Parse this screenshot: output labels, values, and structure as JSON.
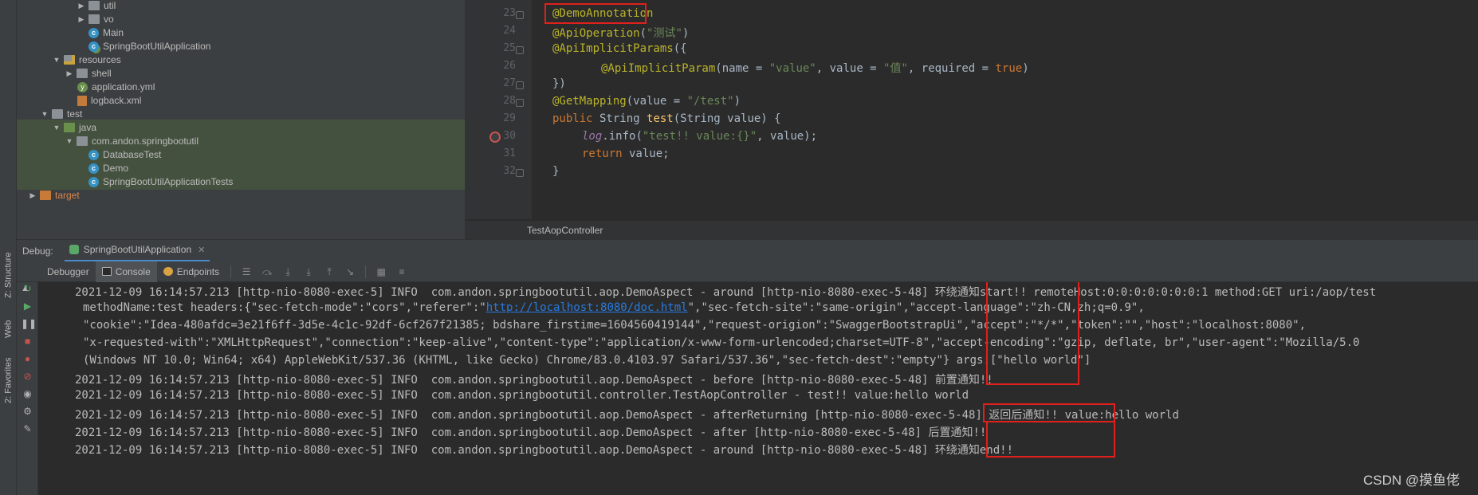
{
  "tree": {
    "items": [
      {
        "label": "util",
        "icon": "folder-icon",
        "indent": 0
      },
      {
        "label": "vo",
        "icon": "folder-icon"
      },
      {
        "label": "Main",
        "icon": "class-icon"
      },
      {
        "label": "SpringBootUtilApplication",
        "icon": "spring-class-icon"
      },
      {
        "label": "resources",
        "icon": "resources-folder-icon"
      },
      {
        "label": "shell",
        "icon": "folder-icon"
      },
      {
        "label": "application.yml",
        "icon": "yml-file-icon"
      },
      {
        "label": "logback.xml",
        "icon": "xml-file-icon"
      },
      {
        "label": "test",
        "icon": "folder-icon"
      },
      {
        "label": "java",
        "icon": "test-folder-icon"
      },
      {
        "label": "com.andon.springbootutil",
        "icon": "package-icon"
      },
      {
        "label": "DatabaseTest",
        "icon": "class-icon"
      },
      {
        "label": "Demo",
        "icon": "class-icon"
      },
      {
        "label": "SpringBootUtilApplicationTests",
        "icon": "class-icon"
      },
      {
        "label": "target",
        "icon": "excluded-folder-icon"
      }
    ]
  },
  "sidebar": {
    "structure": "Z: Structure",
    "web": "Web",
    "favorites": "2: Favorites"
  },
  "editor": {
    "lines": [
      "23",
      "24",
      "25",
      "26",
      "27",
      "28",
      "29",
      "30",
      "31",
      "32"
    ],
    "code": {
      "l23": "@DemoAnnotation",
      "l24_ann": "@ApiOperation",
      "l24_open": "(",
      "l24_str": "\"测试\"",
      "l24_close": ")",
      "l25_ann": "@ApiImplicitParams",
      "l25_rest": "({",
      "l26_ann": "@ApiImplicitParam",
      "l26_a": "(name = ",
      "l26_s1": "\"value\"",
      "l26_b": ", value = ",
      "l26_s2": "\"值\"",
      "l26_c": ", required = ",
      "l26_kw": "true",
      "l26_d": ")",
      "l27": "})",
      "l28_ann": "@GetMapping",
      "l28_a": "(value = ",
      "l28_s": "\"/test\"",
      "l28_b": ")",
      "l29_kw": "public",
      "l29_a": " String ",
      "l29_fn": "test",
      "l29_b": "(String value) {",
      "l30_log": "log",
      "l30_a": ".info(",
      "l30_s": "\"test!! value:{}\"",
      "l30_b": ", value);",
      "l31_kw": "return",
      "l31_a": " value;",
      "l32": "}"
    },
    "breadcrumb": "TestAopController"
  },
  "debug": {
    "label": "Debug:",
    "session": "SpringBootUtilApplication",
    "tabs": [
      "Debugger",
      "Console",
      "Endpoints"
    ]
  },
  "console": {
    "lines": [
      "2021-12-09 16:14:57.213 [http-nio-8080-exec-5] INFO  com.andon.springbootutil.aop.DemoAspect - around [http-nio-8080-exec-5-48] 环绕通知start!! remoteHost:0:0:0:0:0:0:0:1 method:GET uri:/aop/test",
      "methodName:test headers:{\"sec-fetch-mode\":\"cors\",\"referer\":\"",
      "http://localhost:8080/doc.html",
      "\",\"sec-fetch-site\":\"same-origin\",\"accept-language\":\"zh-CN,zh;q=0.9\",",
      "\"cookie\":\"Idea-480afdc=3e21f6ff-3d5e-4c1c-92df-6cf267f21385; bdshare_firstime=1604560419144\",\"request-origion\":\"SwaggerBootstrapUi\",\"accept\":\"*/*\",\"token\":\"\",\"host\":\"localhost:8080\",",
      "\"x-requested-with\":\"XMLHttpRequest\",\"connection\":\"keep-alive\",\"content-type\":\"application/x-www-form-urlencoded;charset=UTF-8\",\"accept-encoding\":\"gzip, deflate, br\",\"user-agent\":\"Mozilla/5.0",
      "(Windows NT 10.0; Win64; x64) AppleWebKit/537.36 (KHTML, like Gecko) Chrome/83.0.4103.97 Safari/537.36\",\"sec-fetch-dest\":\"empty\"} args:[\"hello world\"]",
      "2021-12-09 16:14:57.213 [http-nio-8080-exec-5] INFO  com.andon.springbootutil.aop.DemoAspect - before [http-nio-8080-exec-5-48] 前置通知!!",
      "2021-12-09 16:14:57.213 [http-nio-8080-exec-5] INFO  com.andon.springbootutil.controller.TestAopController - test!! value:hello world",
      "2021-12-09 16:14:57.213 [http-nio-8080-exec-5] INFO  com.andon.springbootutil.aop.DemoAspect - afterReturning [http-nio-8080-exec-5-48] 返回后通知!! value:hello world",
      "2021-12-09 16:14:57.213 [http-nio-8080-exec-5] INFO  com.andon.springbootutil.aop.DemoAspect - after [http-nio-8080-exec-5-48] 后置通知!!",
      "2021-12-09 16:14:57.213 [http-nio-8080-exec-5] INFO  com.andon.springbootutil.aop.DemoAspect - around [http-nio-8080-exec-5-48] 环绕通知end!!"
    ]
  },
  "watermark": "CSDN @摸鱼佬",
  "colors": {
    "highlight_box": "#e0201c",
    "annotation": "#bbb529",
    "string": "#6a8759",
    "keyword": "#cc7832"
  }
}
